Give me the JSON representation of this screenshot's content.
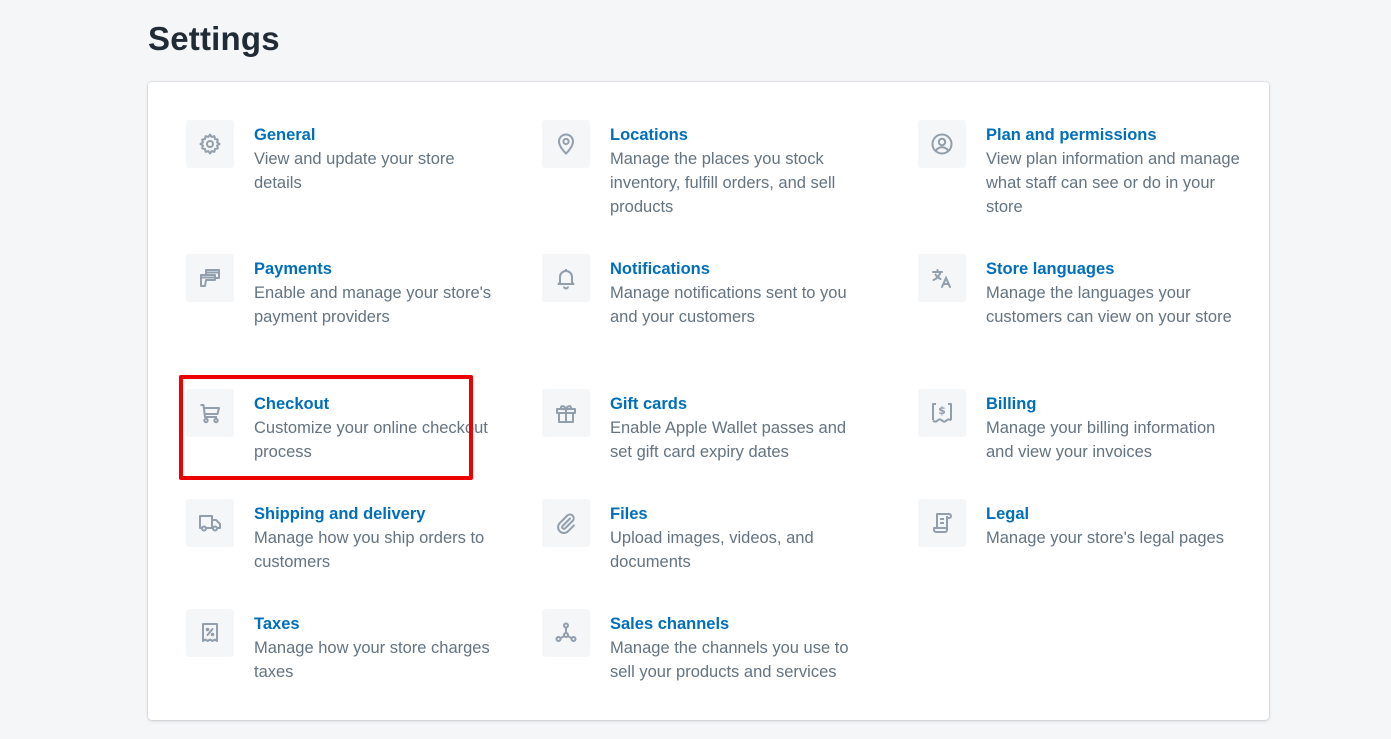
{
  "page": {
    "title": "Settings"
  },
  "colors": {
    "background": "#f4f6f8",
    "card": "#ffffff",
    "link": "#006fbb",
    "description": "#637381",
    "icon": "#919eab",
    "icon_bg": "#f4f6f8",
    "highlight": "#ee0000"
  },
  "settings": {
    "items": [
      {
        "id": "general",
        "icon": "gear-icon",
        "title": "General",
        "description": "View and update your store details"
      },
      {
        "id": "locations",
        "icon": "location-pin-icon",
        "title": "Locations",
        "description": "Manage the places you stock inventory, fulfill orders, and sell products"
      },
      {
        "id": "plan",
        "icon": "user-circle-icon",
        "title": "Plan and permissions",
        "description": "View plan information and manage what staff can see or do in your store"
      },
      {
        "id": "payments",
        "icon": "payment-cards-icon",
        "title": "Payments",
        "description": "Enable and manage your store's payment providers"
      },
      {
        "id": "notifications",
        "icon": "bell-icon",
        "title": "Notifications",
        "description": "Manage notifications sent to you and your customers"
      },
      {
        "id": "languages",
        "icon": "translate-icon",
        "title": "Store languages",
        "description": "Manage the languages your customers can view on your store"
      },
      {
        "id": "checkout",
        "icon": "cart-icon",
        "title": "Checkout",
        "description": "Customize your online checkout process",
        "highlighted": true
      },
      {
        "id": "giftcards",
        "icon": "gift-icon",
        "title": "Gift cards",
        "description": "Enable Apple Wallet passes and set gift card expiry dates"
      },
      {
        "id": "billing",
        "icon": "billing-receipt-icon",
        "title": "Billing",
        "description": "Manage your billing information and view your invoices"
      },
      {
        "id": "shipping",
        "icon": "truck-icon",
        "title": "Shipping and delivery",
        "description": "Manage how you ship orders to customers"
      },
      {
        "id": "files",
        "icon": "paperclip-icon",
        "title": "Files",
        "description": "Upload images, videos, and documents"
      },
      {
        "id": "legal",
        "icon": "scroll-document-icon",
        "title": "Legal",
        "description": "Manage your store's legal pages"
      },
      {
        "id": "taxes",
        "icon": "tax-receipt-icon",
        "title": "Taxes",
        "description": "Manage how your store charges taxes"
      },
      {
        "id": "channels",
        "icon": "sales-channels-icon",
        "title": "Sales channels",
        "description": "Manage the channels you use to sell your products and services"
      }
    ]
  }
}
